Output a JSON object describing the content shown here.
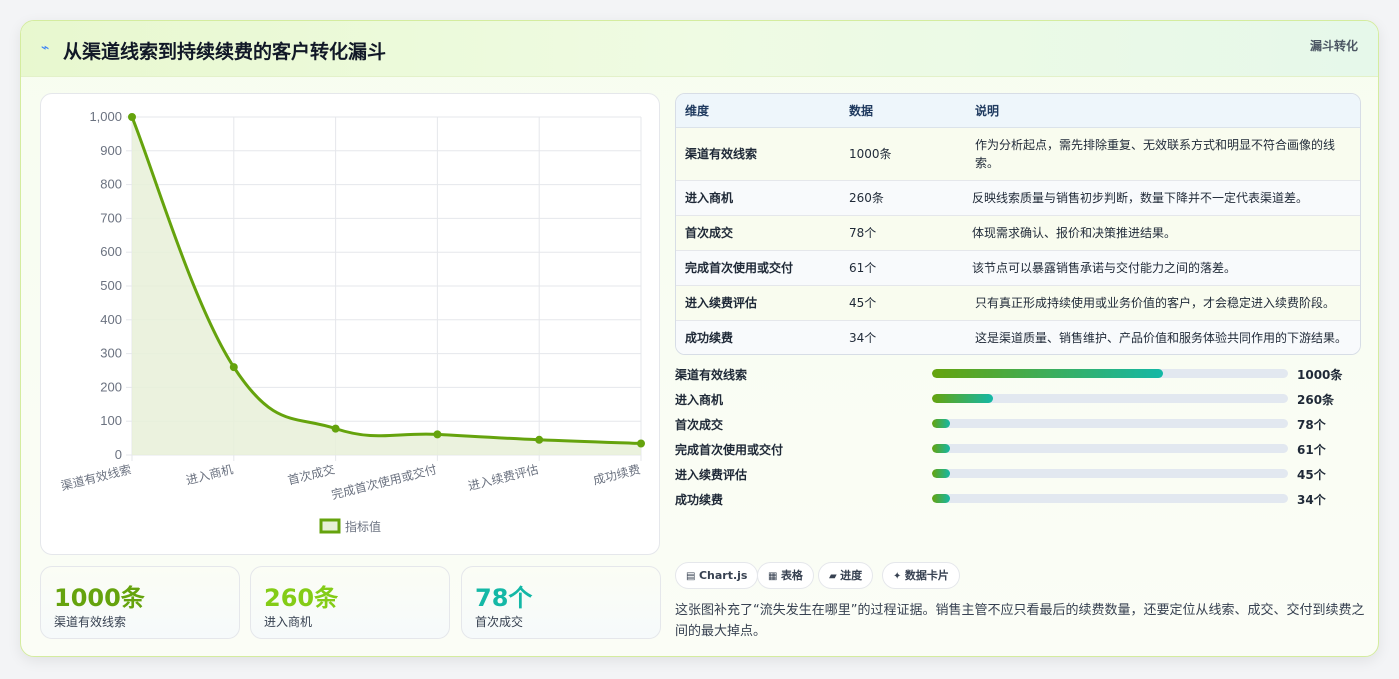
{
  "header": {
    "title_icon": "lightning-icon",
    "title": "从渠道线索到持续续费的客户转化漏斗",
    "tag": "漏斗转化"
  },
  "chart_data": {
    "type": "line",
    "categories": [
      "渠道有效线索",
      "进入商机",
      "首次成交",
      "完成首次使用或交付",
      "进入续费评估",
      "成功续费"
    ],
    "series": [
      {
        "name": "指标值",
        "values": [
          1000,
          260,
          78,
          61,
          45,
          34
        ]
      }
    ],
    "ylim": [
      0,
      1000
    ],
    "yticks": [
      "0",
      "100",
      "200",
      "300",
      "400",
      "500",
      "600",
      "700",
      "800",
      "900",
      "1,000"
    ],
    "grid": true,
    "area_fill": true,
    "legend_position": "bottom",
    "colors": {
      "line": "#65a30d",
      "fill": "#e7f0d8"
    }
  },
  "stats": [
    {
      "value": "1000条",
      "label": "渠道有效线索",
      "color": "#65a30d"
    },
    {
      "value": "260条",
      "label": "进入商机",
      "color": "#84cc16"
    },
    {
      "value": "78个",
      "label": "首次成交",
      "color": "#14b8a6"
    }
  ],
  "table": {
    "headers": [
      "维度",
      "数据",
      "说明"
    ],
    "rows": [
      {
        "dim": "渠道有效线索",
        "value": "1000条",
        "desc": "作为分析起点，需先排除重复、无效联系方式和明显不符合画像的线索。"
      },
      {
        "dim": "进入商机",
        "value": "260条",
        "desc": "反映线索质量与销售初步判断，数量下降并不一定代表渠道差。"
      },
      {
        "dim": "首次成交",
        "value": "78个",
        "desc": "体现需求确认、报价和决策推进结果。"
      },
      {
        "dim": "完成首次使用或交付",
        "value": "61个",
        "desc": "该节点可以暴露销售承诺与交付能力之间的落差。"
      },
      {
        "dim": "进入续费评估",
        "value": "45个",
        "desc": "只有真正形成持续使用或业务价值的客户，才会稳定进入续费阶段。"
      },
      {
        "dim": "成功续费",
        "value": "34个",
        "desc": "这是渠道质量、销售维护、产品价值和服务体验共同作用的下游结果。"
      }
    ]
  },
  "progress": [
    {
      "label": "渠道有效线索",
      "value": "1000条",
      "fraction": 0.65
    },
    {
      "label": "进入商机",
      "value": "260条",
      "fraction": 0.17
    },
    {
      "label": "首次成交",
      "value": "78个",
      "fraction": 0.05
    },
    {
      "label": "完成首次使用或交付",
      "value": "61个",
      "fraction": 0.05
    },
    {
      "label": "进入续费评估",
      "value": "45个",
      "fraction": 0.05
    },
    {
      "label": "成功续费",
      "value": "34个",
      "fraction": 0.05
    }
  ],
  "badges": [
    {
      "icon": "chart-icon",
      "glyph": "▤",
      "label": "Chart.js"
    },
    {
      "icon": "table-icon",
      "glyph": "▦",
      "label": "表格"
    },
    {
      "icon": "progress-icon",
      "glyph": "▰",
      "label": "进度"
    },
    {
      "icon": "sparkle-icon",
      "glyph": "✦",
      "label": "数据卡片"
    }
  ],
  "note": "这张图补充了“流失发生在哪里”的过程证据。销售主管不应只看最后的续费数量，还要定位从线索、成交、交付到续费之间的最大掉点。"
}
